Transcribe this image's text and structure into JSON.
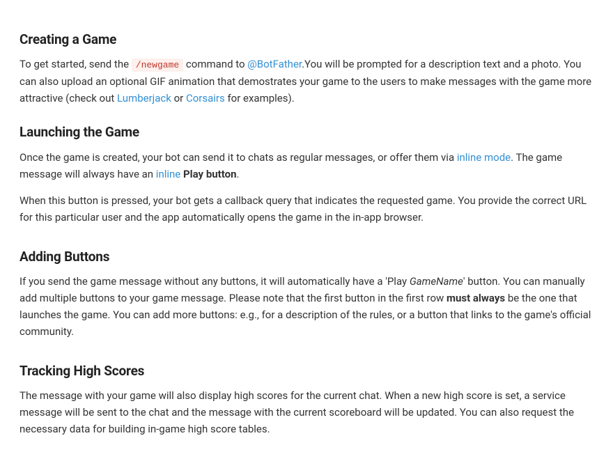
{
  "sections": {
    "creating": {
      "heading": "Creating a Game",
      "p1_part1": "To get started, send the ",
      "p1_code": "/newgame",
      "p1_part2": " command to ",
      "p1_link1": "@BotFather",
      "p1_part3": ".You will be prompted for a description text and a photo. You can also upload an optional GIF animation that demostrates your game to the users to make messages with the game more attractive (check out ",
      "p1_link2": "Lumberjack",
      "p1_part4": " or ",
      "p1_link3": "Corsairs",
      "p1_part5": " for examples)."
    },
    "launching": {
      "heading": "Launching the Game",
      "p1_part1": "Once the game is created, your bot can send it to chats as regular messages, or offer them via ",
      "p1_link1": "inline mode",
      "p1_part2": ". The game message will always have an ",
      "p1_link2": "inline",
      "p1_part3": " ",
      "p1_bold": "Play button",
      "p1_part4": ".",
      "p2": "When this button is pressed, your bot gets a callback query that indicates the requested game. You provide the correct URL for this particular user and the app automatically opens the game in the in-app browser."
    },
    "adding": {
      "heading": "Adding Buttons",
      "p1_part1": "If you send the game message without any buttons, it will automatically have a 'Play ",
      "p1_italic": "GameName",
      "p1_part2": "' button. You can manually add multiple buttons to your game message. Please note that the first button in the first row ",
      "p1_bold": "must always",
      "p1_part3": " be the one that launches the game. You can add more buttons: e.g., for a description of the rules, or a button that links to the game's official community."
    },
    "tracking": {
      "heading": "Tracking High Scores",
      "p1": "The message with your game will also display high scores for the current chat. When a new high score is set, a service message will be sent to the chat and the message with the current scoreboard will be updated. You can also request the necessary data for building in-game high score tables."
    }
  }
}
